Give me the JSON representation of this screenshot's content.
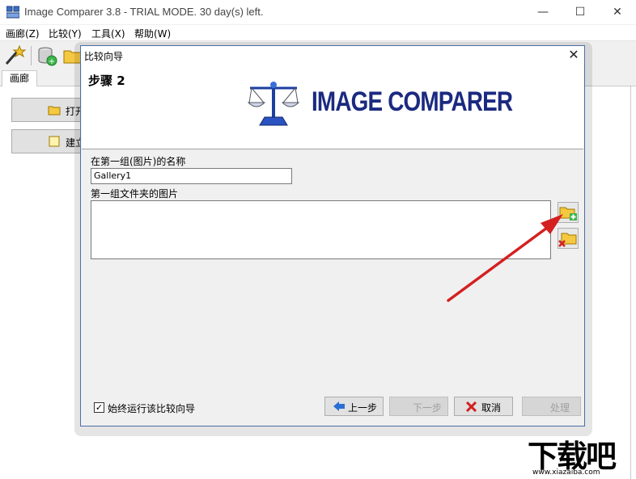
{
  "window": {
    "title": "Image Comparer 3.8 - TRIAL MODE. 30 day(s) left.",
    "minimize": "—",
    "maximize": "☐",
    "close": "✕"
  },
  "menu": {
    "items": [
      "画廊(Z)",
      "比较(Y)",
      "工具(X)",
      "帮助(W)"
    ]
  },
  "tabs": {
    "gallery": "画廊"
  },
  "background_buttons": {
    "open": "打开",
    "create": "建立"
  },
  "dialog": {
    "title": "比较向导",
    "close": "✕",
    "step": "步骤 2",
    "logo_text": "IMAGE COMPARER",
    "name_label": "在第一组(图片)的名称",
    "name_value": "Gallery1",
    "folder_label": "第一组文件夹的图片",
    "always_run_label": "始终运行该比较向导",
    "always_run_checked": true,
    "buttons": {
      "prev": "上一步",
      "next": "下一步",
      "cancel": "取消",
      "process": "处理"
    }
  },
  "watermark": {
    "text": "下载吧",
    "sub": "www.xiazaiba.com"
  },
  "colors": {
    "logo_text": "#1b2a80",
    "arrow": "#d42020",
    "dialog_border": "#4a6fa5"
  }
}
